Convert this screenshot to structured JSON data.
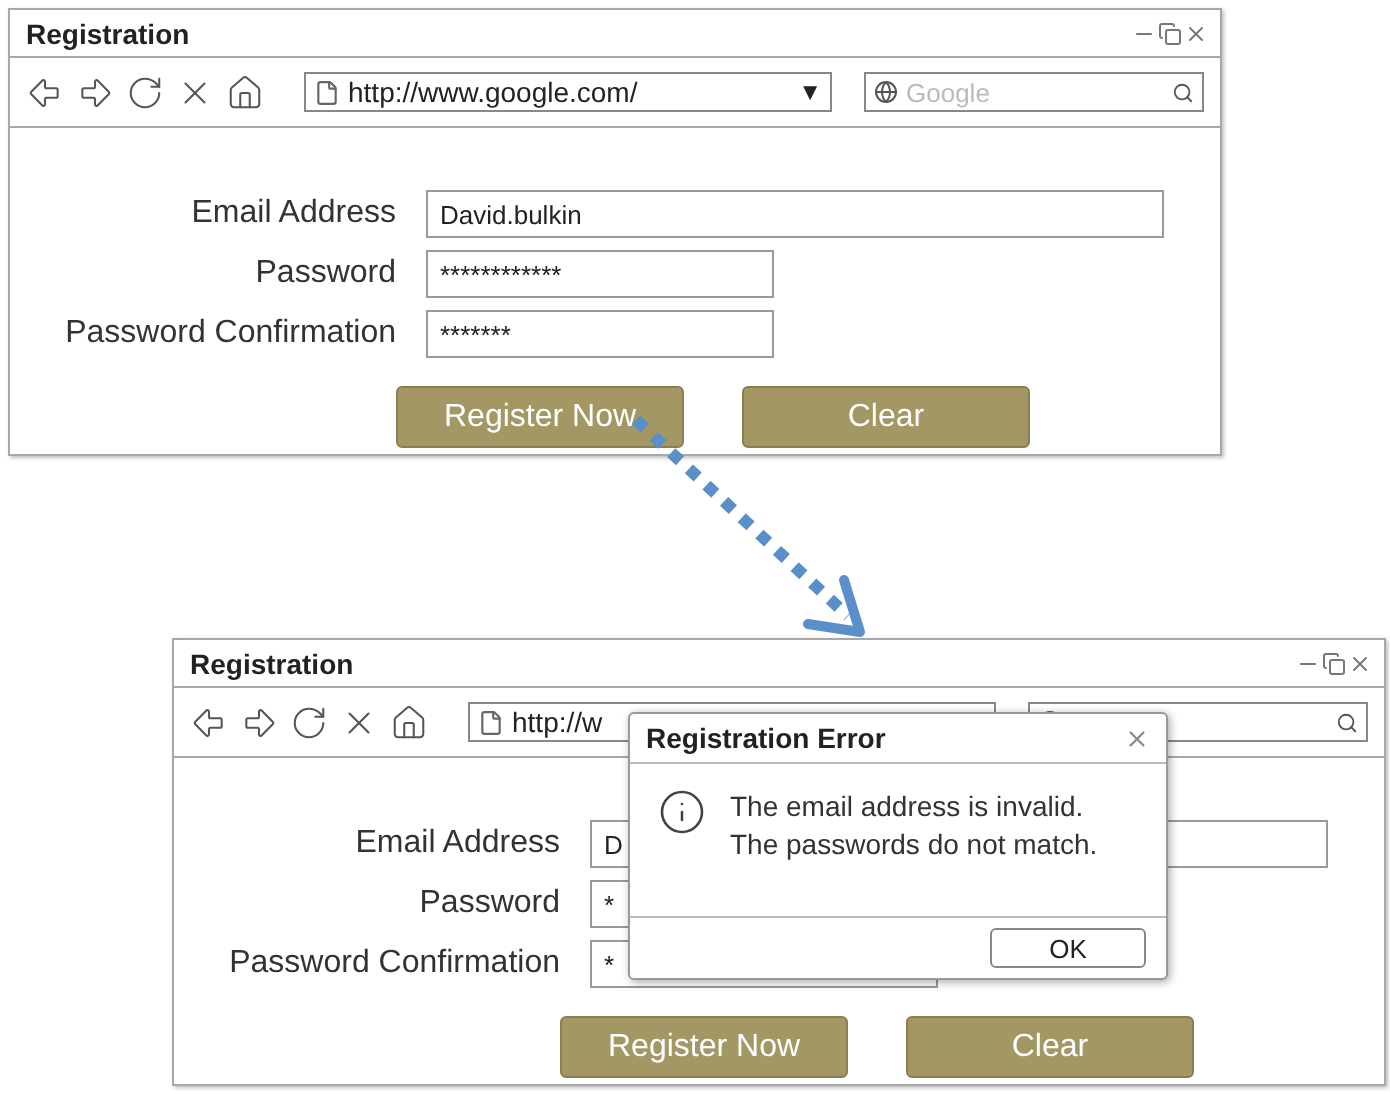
{
  "windows": [
    {
      "title": "Registration",
      "address": "http://www.google.com/",
      "address_menu": "▼",
      "search": {
        "placeholder": "Google"
      },
      "fields": [
        {
          "label": "Email Address",
          "value": "David.bulkin",
          "kind": "wide"
        },
        {
          "label": "Password",
          "value": "************",
          "kind": "narrow"
        },
        {
          "label": "Password Confirmation",
          "value": "*******",
          "kind": "narrow"
        }
      ],
      "buttons": [
        "Register Now",
        "Clear"
      ]
    },
    {
      "title": "Registration",
      "address": "http://w",
      "fields": [
        {
          "label": "Email Address",
          "value": "D",
          "kind": "wide"
        },
        {
          "label": "Password",
          "value": "*",
          "kind": "narrow"
        },
        {
          "label": "Password Confirmation",
          "value": "*",
          "kind": "narrow"
        }
      ],
      "buttons": [
        "Register Now",
        "Clear"
      ]
    }
  ],
  "dialog": {
    "title": "Registration Error",
    "message": [
      "The email address is invalid.",
      "The passwords do not match."
    ],
    "button": "OK"
  }
}
